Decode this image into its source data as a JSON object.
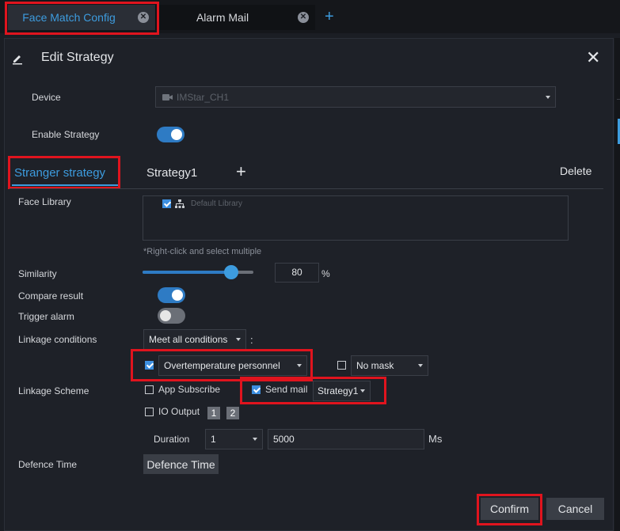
{
  "tabs": [
    {
      "label": "Face Match Config"
    },
    {
      "label": "Alarm Mail"
    }
  ],
  "add_tab_symbol": "+",
  "dialog": {
    "title": "Edit Strategy",
    "close_symbol": "✕"
  },
  "device": {
    "label": "Device",
    "value": "IMStar_CH1"
  },
  "enable_strategy": {
    "label": "Enable Strategy",
    "on": true
  },
  "strategy_tabs": {
    "items": [
      "Stranger strategy",
      "Strategy1"
    ],
    "active": "Stranger strategy",
    "add_symbol": "+",
    "delete_label": "Delete"
  },
  "face_library": {
    "label": "Face Library",
    "items": [
      {
        "name": "Default Library",
        "checked": true
      }
    ],
    "hint": "*Right-click and select multiple"
  },
  "similarity": {
    "label": "Similarity",
    "value": "80",
    "unit": "%",
    "level": 0.8
  },
  "compare_result": {
    "label": "Compare result",
    "on": true
  },
  "trigger_alarm": {
    "label": "Trigger alarm",
    "on": false
  },
  "linkage_conditions": {
    "label": "Linkage conditions",
    "mode": "Meet all conditions",
    "colon": ":",
    "condition1": {
      "checked": true,
      "value": "Overtemperature personnel"
    },
    "condition2": {
      "checked": false,
      "value": "No mask"
    }
  },
  "linkage_scheme": {
    "label": "Linkage Scheme",
    "app_subscribe": {
      "label": "App Subscribe",
      "checked": false
    },
    "send_mail": {
      "label": "Send mail",
      "checked": true,
      "value": "Strategy1"
    },
    "io_output": {
      "label": "IO Output",
      "checked": false,
      "ports": [
        "1",
        "2"
      ]
    },
    "duration": {
      "label": "Duration",
      "select": "1",
      "value": "5000",
      "unit": "Ms"
    }
  },
  "defence_time": {
    "label": "Defence Time",
    "button": "Defence Time"
  },
  "footer": {
    "confirm": "Confirm",
    "cancel": "Cancel"
  },
  "colors": {
    "accent": "#3d9cdf",
    "highlight_box": "#e0141e",
    "toggle_on": "#2e7bc4",
    "toggle_off": "#6b6f77",
    "background": "#1e2128"
  }
}
